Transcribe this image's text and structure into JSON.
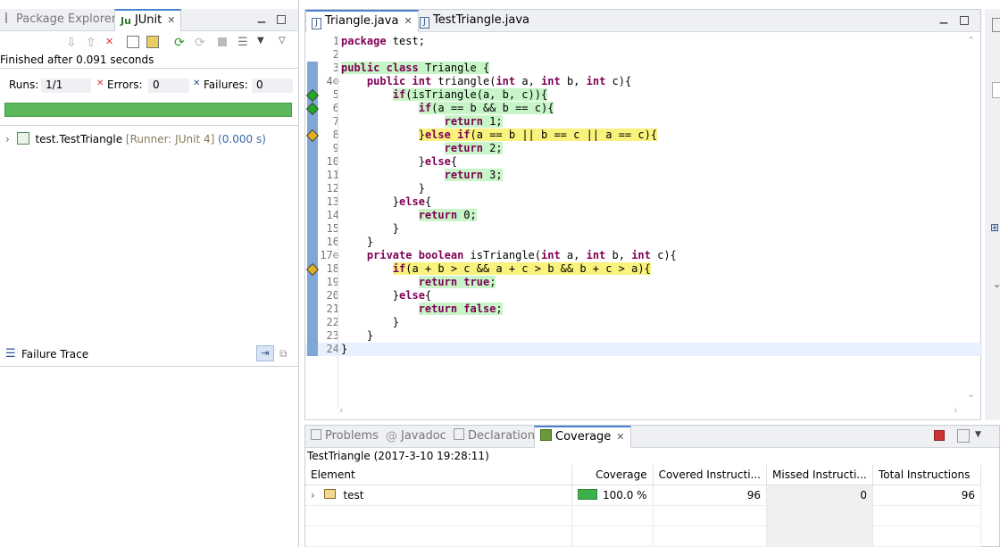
{
  "left_panel": {
    "tabs": [
      {
        "label": "Package Explorer",
        "active": false
      },
      {
        "label": "JUnit",
        "active": true
      }
    ],
    "status": "Finished after 0.091 seconds",
    "runs_label": "Runs:",
    "runs_value": "1/1",
    "errors_label": "Errors:",
    "errors_value": "0",
    "failures_label": "Failures:",
    "failures_value": "0",
    "progress": 1.0,
    "progress_color": "#5cb85c",
    "test_name": "test.TestTriangle",
    "test_runner": "[Runner: JUnit 4]",
    "test_time": "(0.000 s)",
    "failure_trace_label": "Failure Trace"
  },
  "editor": {
    "tabs": [
      {
        "label": "Triangle.java",
        "active": true
      },
      {
        "label": "TestTriangle.java",
        "active": false
      }
    ],
    "lines": [
      {
        "n": "1",
        "text": "package test;",
        "hl": "none"
      },
      {
        "n": "2",
        "text": "",
        "hl": "none"
      },
      {
        "n": "3",
        "text": "public class Triangle {",
        "hl": "green"
      },
      {
        "n": "4⊖",
        "text": "    public int triangle(int a, int b, int c){",
        "hl": "none"
      },
      {
        "n": "5",
        "text": "        if(isTriangle(a, b, c)){",
        "hl": "green"
      },
      {
        "n": "6",
        "text": "            if(a == b && b == c){",
        "hl": "green"
      },
      {
        "n": "7",
        "text": "                return 1;",
        "hl": "green"
      },
      {
        "n": "8",
        "text": "            }else if(a == b || b == c || a == c){",
        "hl": "yellow"
      },
      {
        "n": "9",
        "text": "                return 2;",
        "hl": "green"
      },
      {
        "n": "10",
        "text": "            }else{",
        "hl": "none"
      },
      {
        "n": "11",
        "text": "                return 3;",
        "hl": "green"
      },
      {
        "n": "12",
        "text": "            }",
        "hl": "none"
      },
      {
        "n": "13",
        "text": "        }else{",
        "hl": "none"
      },
      {
        "n": "14",
        "text": "            return 0;",
        "hl": "green"
      },
      {
        "n": "15",
        "text": "        }",
        "hl": "none"
      },
      {
        "n": "16",
        "text": "    }",
        "hl": "none"
      },
      {
        "n": "17⊖",
        "text": "    private boolean isTriangle(int a, int b, int c){",
        "hl": "none"
      },
      {
        "n": "18",
        "text": "        if(a + b > c && a + c > b && b + c > a){",
        "hl": "yellow"
      },
      {
        "n": "19",
        "text": "            return true;",
        "hl": "green"
      },
      {
        "n": "20",
        "text": "        }else{",
        "hl": "none"
      },
      {
        "n": "21",
        "text": "            return false;",
        "hl": "green"
      },
      {
        "n": "22",
        "text": "        }",
        "hl": "none"
      },
      {
        "n": "23",
        "text": "    }",
        "hl": "none"
      },
      {
        "n": "24",
        "text": "}",
        "hl": "current"
      }
    ],
    "markers": [
      {
        "line": 5,
        "color": "#22aa22"
      },
      {
        "line": 6,
        "color": "#22aa22"
      },
      {
        "line": 8,
        "color": "#e0b020"
      },
      {
        "line": 18,
        "color": "#e0b020"
      }
    ]
  },
  "bottom_panel": {
    "tabs": [
      {
        "label": "Problems",
        "active": false
      },
      {
        "label": "Javadoc",
        "active": false
      },
      {
        "label": "Declaration",
        "active": false
      },
      {
        "label": "Coverage",
        "active": true
      }
    ],
    "session": "TestTriangle (2017-3-10 19:28:11)",
    "columns": [
      "Element",
      "Coverage",
      "Covered Instructi...",
      "Missed Instructi...",
      "Total Instructions"
    ],
    "rows": [
      {
        "element": "test",
        "coverage": "100.0 %",
        "coverage_fraction": 1.0,
        "covered": "96",
        "missed": "0",
        "total": "96"
      }
    ]
  }
}
